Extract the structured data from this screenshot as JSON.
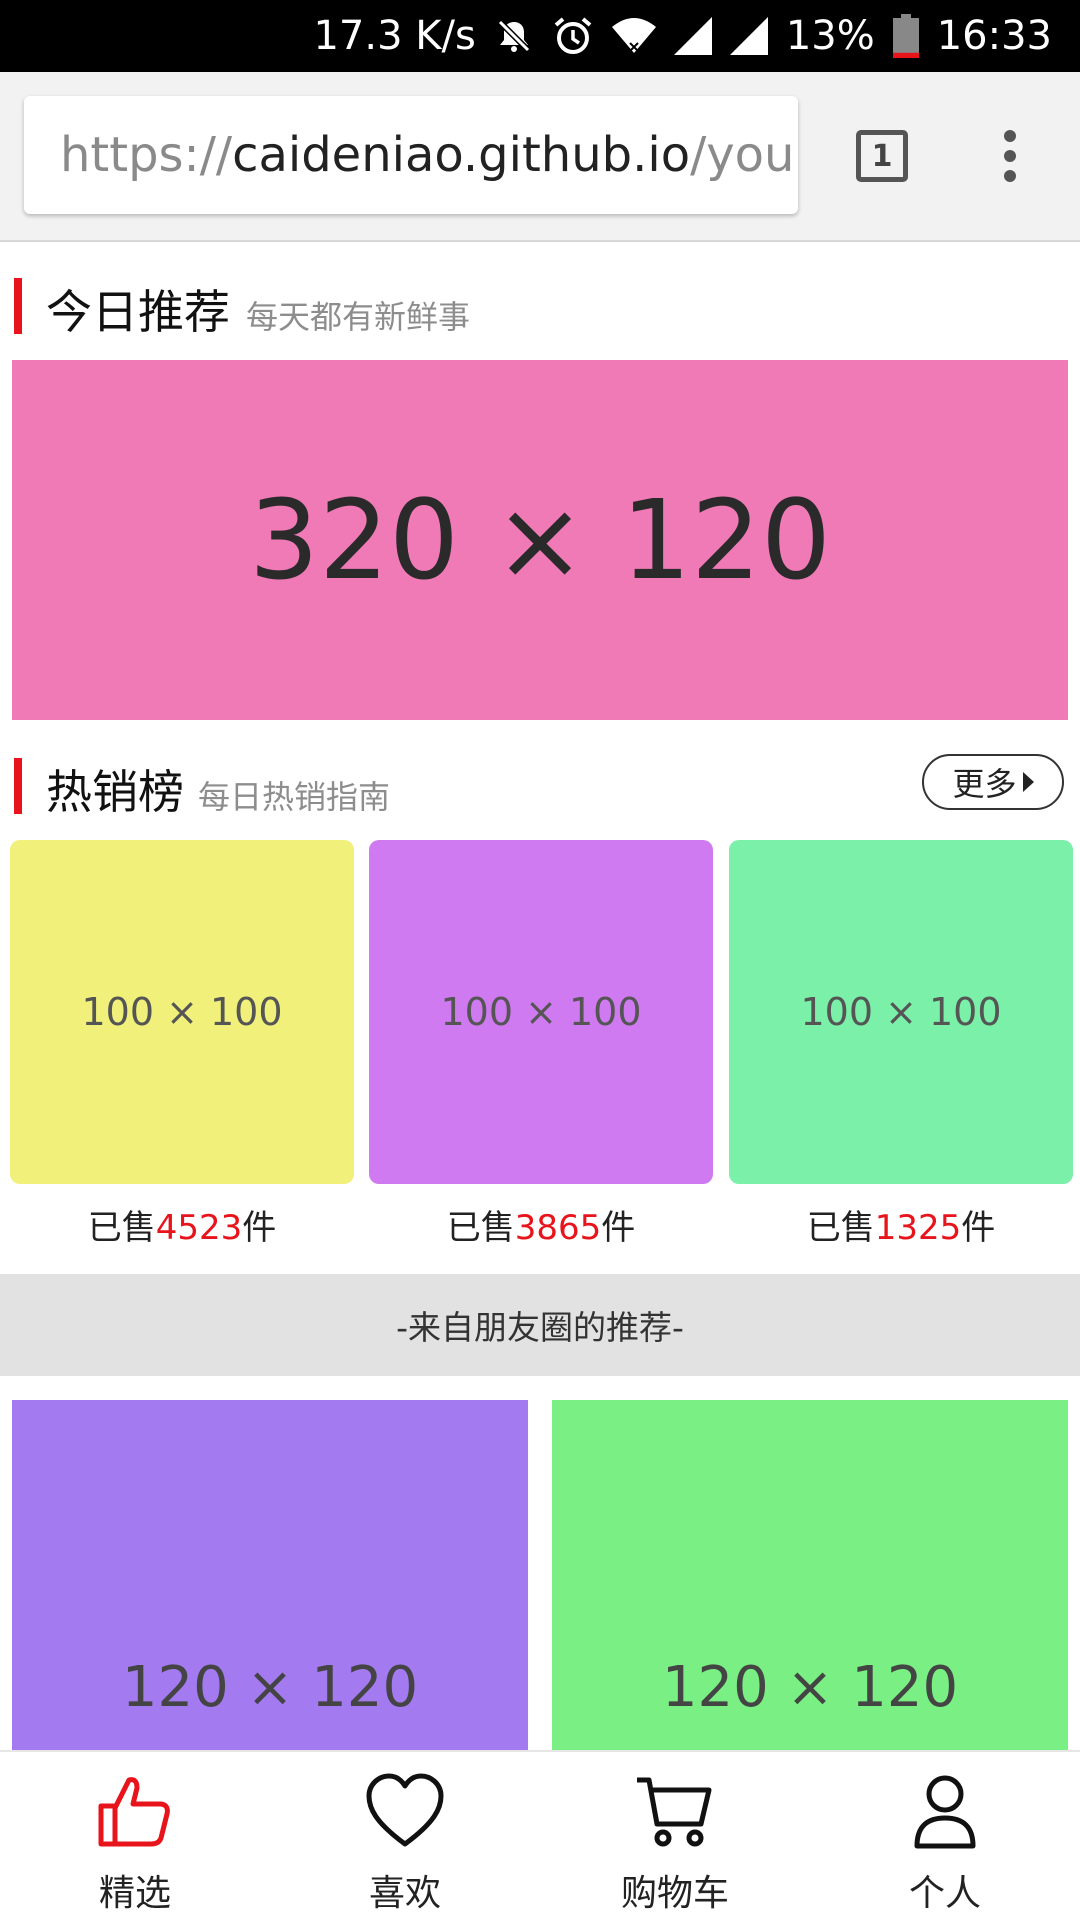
{
  "status_bar": {
    "net_speed": "17.3 K/s",
    "battery_percent": "13%",
    "time": "16:33",
    "icons": [
      "mute-bell-icon",
      "alarm-icon",
      "wifi-icon",
      "signal-icon",
      "signal-icon",
      "battery-icon"
    ],
    "battery_level": 0.13
  },
  "browser": {
    "url_scheme": "https://",
    "url_host": "caideniao.github.io",
    "url_path": "/you",
    "tab_count": "1"
  },
  "today": {
    "title": "今日推荐",
    "subtitle": "每天都有新鲜事",
    "banner_text": "320 × 120",
    "banner_color": "#f07ab6"
  },
  "hot": {
    "title": "热销榜",
    "subtitle": "每日热销指南",
    "more_label": "更多",
    "items": [
      {
        "image_text": "100 × 100",
        "color": "#f0f07a",
        "sold_prefix": "已售",
        "sold_num": "4523",
        "sold_suffix": "件"
      },
      {
        "image_text": "100 × 100",
        "color": "#cf7af0",
        "sold_prefix": "已售",
        "sold_num": "3865",
        "sold_suffix": "件"
      },
      {
        "image_text": "100 × 100",
        "color": "#7af0a8",
        "sold_prefix": "已售",
        "sold_num": "1325",
        "sold_suffix": "件"
      }
    ]
  },
  "friends": {
    "banner_text": "-来自朋友圈的推荐-",
    "items": [
      {
        "image_text": "120 × 120",
        "color": "#a47af0"
      },
      {
        "image_text": "120 × 120",
        "color": "#7af084"
      }
    ]
  },
  "bottom_nav": {
    "items": [
      {
        "label": "精选",
        "icon": "thumbs-up-icon",
        "active": true
      },
      {
        "label": "喜欢",
        "icon": "heart-icon",
        "active": false
      },
      {
        "label": "购物车",
        "icon": "cart-icon",
        "active": false
      },
      {
        "label": "个人",
        "icon": "user-icon",
        "active": false
      }
    ],
    "active_color": "#e8141b"
  }
}
